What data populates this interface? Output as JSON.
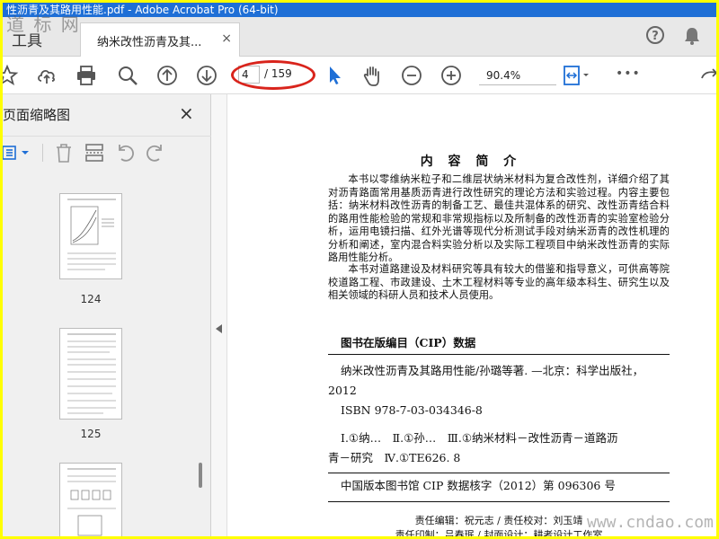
{
  "window": {
    "title": "性沥青及其路用性能.pdf - Adobe Acrobat Pro (64-bit)"
  },
  "tabs": {
    "tools": "工具",
    "document": "纳米改性沥青及其...",
    "close": "×"
  },
  "header_icons": {
    "help": "?",
    "bell": "bell-icon"
  },
  "toolbar": {
    "page_current": "4",
    "page_total": "/ 159",
    "zoom": "90.4%",
    "more": "•••"
  },
  "thumbnail_panel": {
    "title": "页面缩略图",
    "close": "×",
    "pages": [
      {
        "label": "124"
      },
      {
        "label": "125"
      }
    ]
  },
  "document": {
    "title": "内 容 简 介",
    "para1": "本书以零维纳米粒子和二维层状纳米材料为复合改性剂，详细介绍了其对沥青路面常用基质沥青进行改性研究的理论方法和实验过程。内容主要包括：纳米材料改性沥青的制备工艺、最佳共混体系的研究、改性沥青结合料的路用性能检验的常规和非常规指标以及所制备的改性沥青的实验室检验分析，运用电镜扫描、红外光谱等现代分析测试手段对纳米沥青的改性机理的分析和阐述，室内混合料实验分析以及实际工程项目中纳米改性沥青的实际路用性能分析。",
    "para2": "本书对道路建设及材料研究等具有较大的借鉴和指导意义，可供高等院校道路工程、市政建设、土木工程材料等专业的高年级本科生、研究生以及相关领域的科研人员和技术人员使用。",
    "cip_title": "图书在版编目（CIP）数据",
    "cip_line1": "纳米改性沥青及其路用性能/孙璐等著. —北京：科学出版社，",
    "cip_line2": "2012",
    "cip_line3": "ISBN 978-7-03-034346-8",
    "cip_line4": "Ⅰ.①纳…　Ⅱ.①孙…　Ⅲ.①纳米材料－改性沥青－道路沥",
    "cip_line5": "青－研究　Ⅳ.①TE626. 8",
    "cip_line6": "中国版本图书馆 CIP 数据核字（2012）第 096306 号",
    "credit1": "责任编辑：祝元志 / 责任校对：刘玉靖",
    "credit2": "责任印制：吕春珉 / 封面设计：耕者设计工作室"
  },
  "watermarks": {
    "top_left": "道 标 网",
    "bottom_right": "www.cndao.com"
  }
}
